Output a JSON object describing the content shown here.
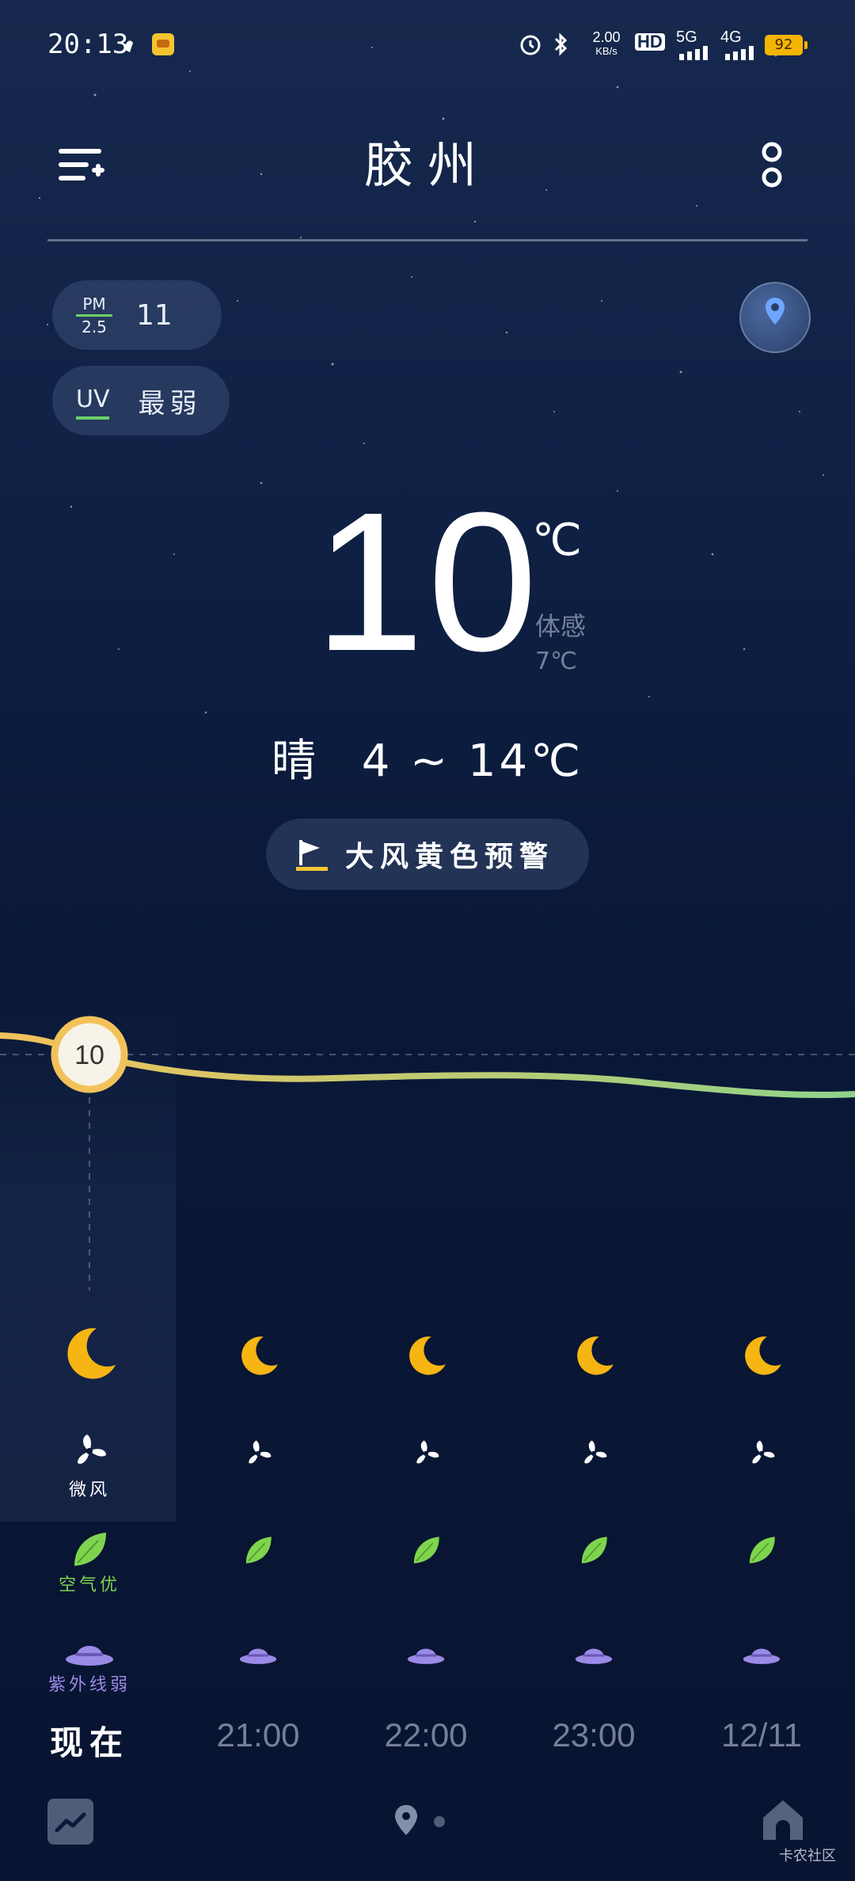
{
  "status_bar": {
    "time": "20:13",
    "net_speed_value": "2.00",
    "net_speed_unit": "KB/s",
    "hd_label": "HD",
    "network_5g": "5G",
    "network_4g": "4G",
    "battery": "92"
  },
  "header": {
    "city": "胶州"
  },
  "chips": {
    "pm_top": "PM",
    "pm_bottom": "2.5",
    "pm_value": "11",
    "uv_label": "UV",
    "uv_value": "最弱"
  },
  "current": {
    "temperature": "10",
    "unit": "℃",
    "feels_like_label": "体感",
    "feels_like_value": "7℃",
    "condition": "晴",
    "range": "4 ~ 14℃"
  },
  "alert": {
    "text": "大风黄色预警",
    "color": "#f4c430"
  },
  "hourly": {
    "chart_temp_label": "10",
    "items": [
      {
        "time": "现在",
        "icon": "moon-icon",
        "wind": "微风",
        "air": "空气优",
        "uv": "紫外线弱"
      },
      {
        "time": "21:00",
        "icon": "moon-icon"
      },
      {
        "time": "22:00",
        "icon": "moon-icon"
      },
      {
        "time": "23:00",
        "icon": "moon-icon"
      },
      {
        "time": "12/11",
        "icon": "moon-icon"
      }
    ]
  },
  "colors": {
    "moon": "#f6b512",
    "leaf": "#7fd44e",
    "hat": "#9b8ae6",
    "curve_start": "#f2c25a",
    "curve_end": "#8ed38a"
  },
  "watermark": "卡农社区"
}
